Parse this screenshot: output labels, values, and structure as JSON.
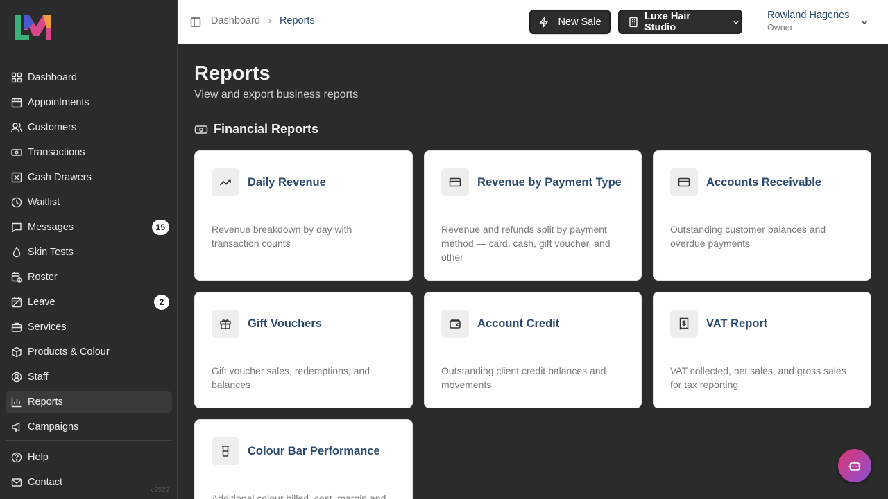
{
  "sidebar": {
    "items": [
      {
        "label": "Dashboard",
        "icon": "grid-icon"
      },
      {
        "label": "Appointments",
        "icon": "calendar-icon"
      },
      {
        "label": "Customers",
        "icon": "users-icon"
      },
      {
        "label": "Transactions",
        "icon": "banknote-icon"
      },
      {
        "label": "Cash Drawers",
        "icon": "square-x-icon"
      },
      {
        "label": "Waitlist",
        "icon": "clock-icon"
      },
      {
        "label": "Messages",
        "icon": "message-icon",
        "badge": "15"
      },
      {
        "label": "Skin Tests",
        "icon": "droplet-icon"
      },
      {
        "label": "Roster",
        "icon": "calendar-clock-icon"
      },
      {
        "label": "Leave",
        "icon": "calendar-off-icon",
        "badge": "2"
      },
      {
        "label": "Services",
        "icon": "briefcase-icon"
      },
      {
        "label": "Products & Colour",
        "icon": "package-icon"
      },
      {
        "label": "Staff",
        "icon": "user-circle-icon"
      },
      {
        "label": "Reports",
        "icon": "bar-chart-icon",
        "active": true
      },
      {
        "label": "Campaigns",
        "icon": "megaphone-icon"
      }
    ],
    "bottom": [
      {
        "label": "Help",
        "icon": "help-circle-icon"
      },
      {
        "label": "Contact",
        "icon": "mail-icon"
      }
    ],
    "version": "v2522"
  },
  "header": {
    "breadcrumb": [
      "Dashboard",
      "Reports"
    ],
    "new_sale_label": "New Sale",
    "studio_label": "Luxe Hair Studio",
    "user_name": "Rowland Hagenes",
    "user_role": "Owner"
  },
  "main": {
    "title": "Reports",
    "subtitle": "View and export business reports",
    "section_title": "Financial Reports",
    "cards": [
      {
        "title": "Daily Revenue",
        "icon": "trending-up-icon",
        "desc": "Revenue breakdown by day with transaction counts"
      },
      {
        "title": "Revenue by Payment Type",
        "icon": "credit-card-icon",
        "desc": "Revenue and refunds split by payment method — card, cash, gift voucher, and other"
      },
      {
        "title": "Accounts Receivable",
        "icon": "credit-card-icon",
        "desc": "Outstanding customer balances and overdue payments"
      },
      {
        "title": "Gift Vouchers",
        "icon": "gift-icon",
        "desc": "Gift voucher sales, redemptions, and balances"
      },
      {
        "title": "Account Credit",
        "icon": "wallet-icon",
        "desc": "Outstanding client credit balances and movements"
      },
      {
        "title": "VAT Report",
        "icon": "receipt-icon",
        "desc": "VAT collected, net sales, and gross sales for tax reporting"
      },
      {
        "title": "Colour Bar Performance",
        "icon": "beaker-icon",
        "desc": "Additional colour billed, cost, margin and"
      }
    ]
  },
  "colors": {
    "accent_text": "#2c4a6e",
    "fab_start": "#e0336f",
    "fab_end": "#8a52d6"
  }
}
